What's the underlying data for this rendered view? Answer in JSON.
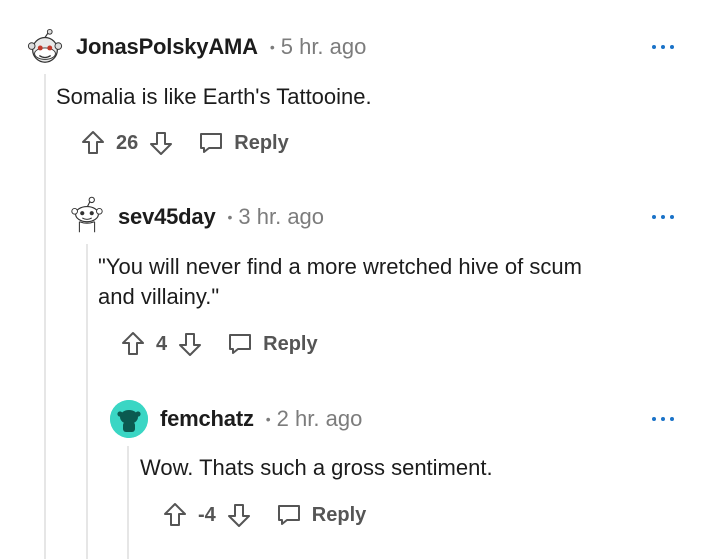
{
  "comments": [
    {
      "username": "JonasPolskyAMA",
      "separator": "•",
      "timestamp": "5 hr. ago",
      "body": "Somalia is like Earth's Tattooine.",
      "score": "26",
      "reply_label": "Reply",
      "avatar_icon": "reddit-snoo-avatar-icon"
    },
    {
      "username": "sev45day",
      "separator": "•",
      "timestamp": "3 hr. ago",
      "body_line1": "\"You will never find a more wretched hive of scum",
      "body_line2": "and villainy.\"",
      "score": "4",
      "reply_label": "Reply",
      "avatar_icon": "reddit-snoo-avatar-icon"
    },
    {
      "username": "femchatz",
      "separator": "•",
      "timestamp": "2 hr. ago",
      "body": "Wow. Thats such a gross sentiment.",
      "score": "-4",
      "reply_label": "Reply",
      "avatar_icon": "reddit-snoo-avatar-icon"
    }
  ],
  "colors": {
    "more_dots": "#1a73c8",
    "avatar3_bg": "#3ad6c4",
    "thread_line": "#e6e6e6",
    "meta_gray": "#7c7c7c"
  }
}
